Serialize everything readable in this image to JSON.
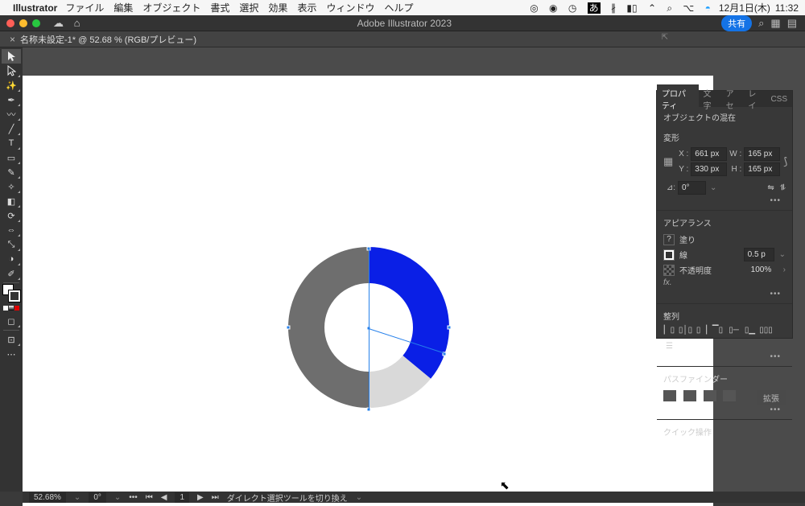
{
  "macmenu": {
    "app": "Illustrator",
    "items": [
      "ファイル",
      "編集",
      "オブジェクト",
      "書式",
      "選択",
      "効果",
      "表示",
      "ウィンドウ",
      "ヘルプ"
    ],
    "date": "12月1日(木)",
    "time": "11:32"
  },
  "appbar": {
    "title": "Adobe Illustrator 2023",
    "share": "共有"
  },
  "doc_tab": {
    "label": "名称未設定-1* @ 52.68 % (RGB/プレビュー)",
    "close": "×"
  },
  "properties": {
    "tabs": [
      "プロパティ",
      "文字",
      "アセ",
      "レイ",
      "CSS"
    ],
    "selection_label": "オブジェクトの混在",
    "transform": {
      "header": "変形",
      "x_label": "X :",
      "x_val": "661 px",
      "w_label": "W :",
      "w_val": "165 px",
      "y_label": "Y :",
      "y_val": "330 px",
      "h_label": "H :",
      "h_val": "165 px",
      "angle_label": "⊿:",
      "angle_val": "0°"
    },
    "appearance": {
      "header": "アピアランス",
      "fill": "塗り",
      "stroke": "線",
      "stroke_val": "0.5 p",
      "opacity": "不透明度",
      "opacity_val": "100%",
      "fx": "fx."
    },
    "align": {
      "header": "整列"
    },
    "pathfinder": {
      "header": "パスファインダー",
      "expand": "拡張"
    },
    "quick": {
      "header": "クイック操作"
    }
  },
  "status": {
    "zoom": "52.68%",
    "rotate": "0°",
    "artboard": "1",
    "hint": "ダイレクト選択ツールを切り換え"
  },
  "chart_data": {
    "type": "pie",
    "note": "donut chart on artboard",
    "series": [
      {
        "name": "blue",
        "value": 36,
        "color": "#0a1fe6"
      },
      {
        "name": "light-gray",
        "value": 14,
        "color": "#d9d9d9"
      },
      {
        "name": "dark-gray",
        "value": 50,
        "color": "#6e6e6e"
      }
    ],
    "inner_radius_ratio": 0.55
  }
}
